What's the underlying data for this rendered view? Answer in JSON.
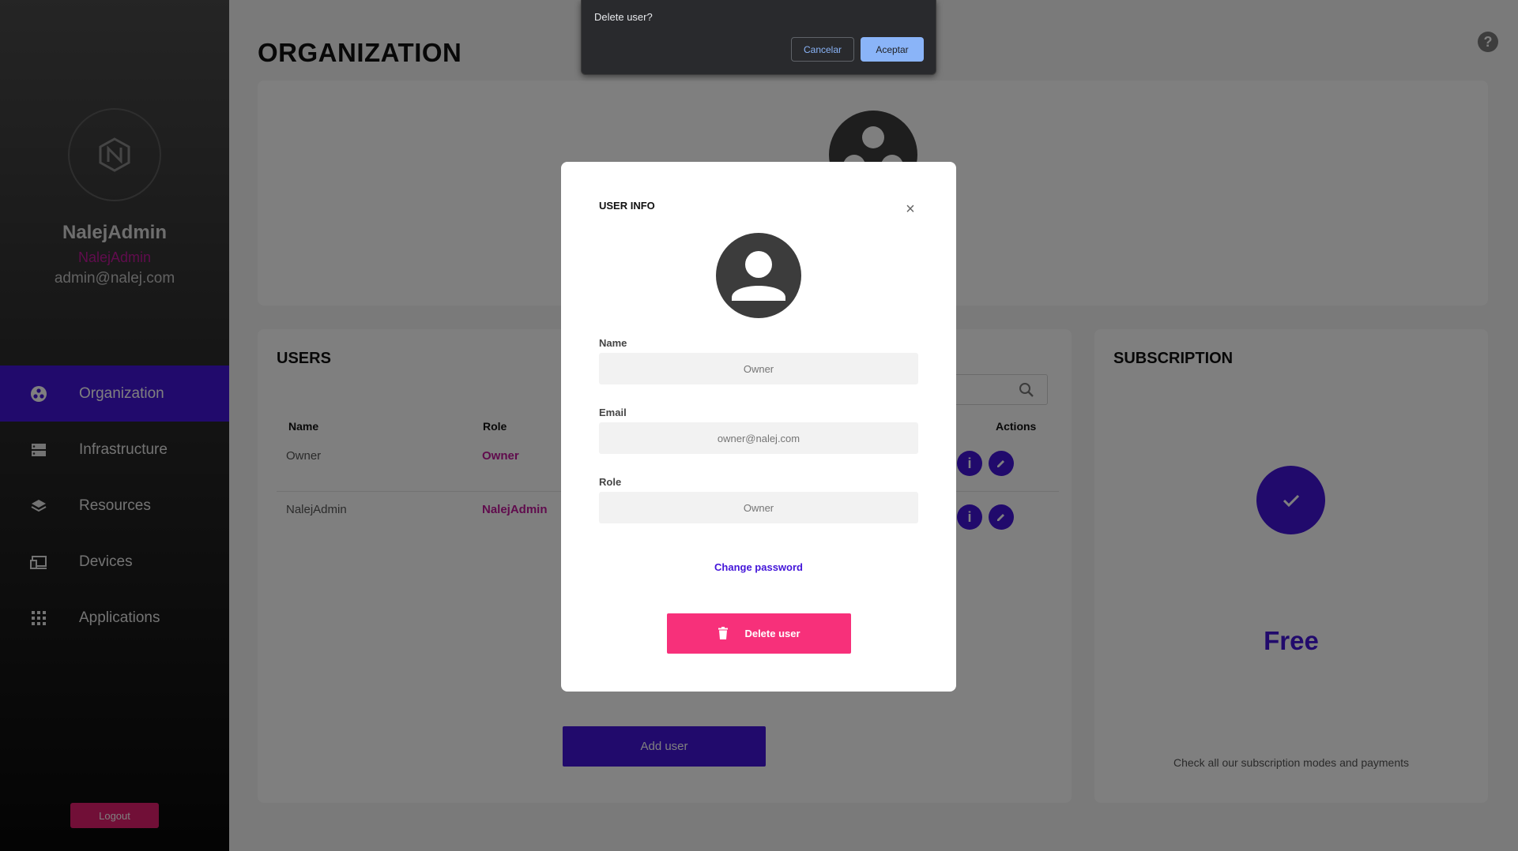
{
  "sidebar": {
    "user_name": "NalejAdmin",
    "user_role": "NalejAdmin",
    "user_email": "admin@nalej.com",
    "nav": [
      {
        "label": "Organization",
        "icon": "organization-icon",
        "active": true
      },
      {
        "label": "Infrastructure",
        "icon": "server-icon"
      },
      {
        "label": "Resources",
        "icon": "layers-icon"
      },
      {
        "label": "Devices",
        "icon": "devices-icon"
      },
      {
        "label": "Applications",
        "icon": "grid-icon"
      }
    ],
    "logout_label": "Logout"
  },
  "main": {
    "title": "ORGANIZATION",
    "help_label": "?"
  },
  "users": {
    "title": "USERS",
    "columns": {
      "name": "Name",
      "role": "Role",
      "actions": "Actions"
    },
    "rows": [
      {
        "name": "Owner",
        "role": "Owner"
      },
      {
        "name": "NalejAdmin",
        "role": "NalejAdmin"
      }
    ],
    "info_label": "i",
    "add_user_label": "Add user"
  },
  "subscription": {
    "title": "SUBSCRIPTION",
    "plan": "Free",
    "note": "Check all our subscription modes and payments"
  },
  "modal": {
    "title": "USER INFO",
    "close": "×",
    "name_label": "Name",
    "name_placeholder": "Owner",
    "email_label": "Email",
    "email_placeholder": "owner@nalej.com",
    "role_label": "Role",
    "role_placeholder": "Owner",
    "change_password": "Change password",
    "delete_label": "Delete user"
  },
  "confirm": {
    "message": "Delete user?",
    "cancel": "Cancelar",
    "accept": "Aceptar"
  },
  "colors": {
    "accent": "#4315d9",
    "role_text": "#c0189a",
    "delete": "#f7307a",
    "logout": "#e31f6f"
  }
}
